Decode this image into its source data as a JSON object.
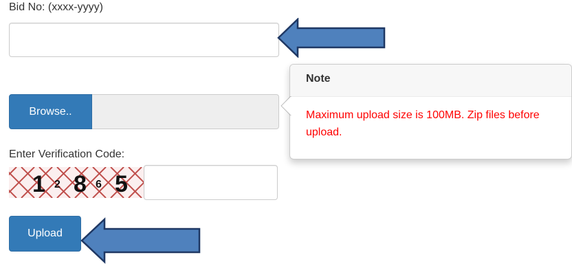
{
  "form": {
    "bid_no_label": "Bid No: (xxxx-yyyy)",
    "bid_no_value": "",
    "browse_label": "Browse..",
    "file_name": "",
    "verification_label": "Enter Verification Code:",
    "captcha_text": "12865",
    "captcha_glyphs": [
      "1",
      "2",
      "8",
      "6",
      "5"
    ],
    "verification_value": "",
    "upload_label": "Upload"
  },
  "popover": {
    "title": "Note",
    "message": "Maximum upload size is 100MB. Zip files before upload."
  },
  "colors": {
    "primary": "#337ab7",
    "error_text": "#ff0000",
    "arrow_fill": "#4f81bd",
    "arrow_stroke": "#1f3864",
    "captcha_hatch": "#c0504d"
  }
}
